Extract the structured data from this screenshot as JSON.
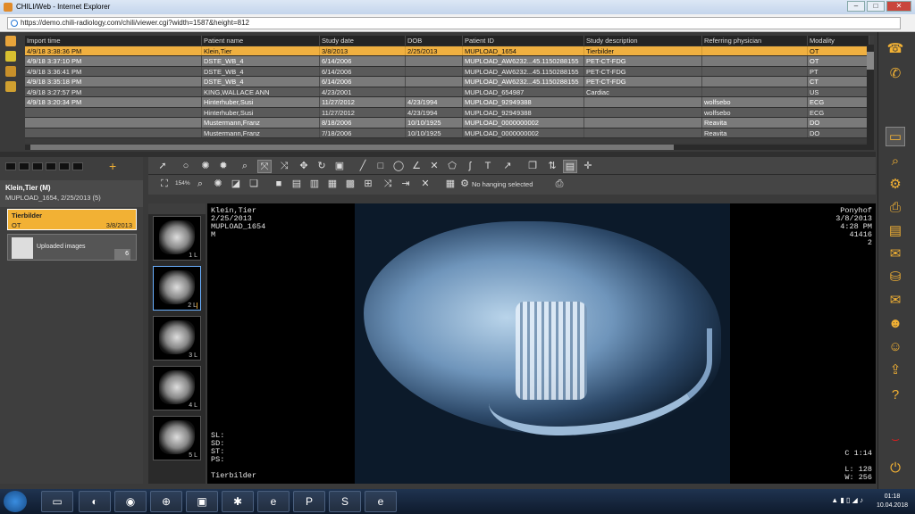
{
  "window": {
    "title": "CHILI/Web - Internet Explorer",
    "url": "https://demo.chili-radiology.com/chili/viewer.cgi?width=1587&height=812"
  },
  "table": {
    "headers": [
      "Import time",
      "Patient name",
      "Study date",
      "DOB",
      "Patient ID",
      "Study description",
      "Referring physician",
      "Modality"
    ],
    "rows": [
      {
        "style": "sel",
        "cells": [
          "4/9/18 3:38:36 PM",
          "Klein,Tier",
          "3/8/2013",
          "2/25/2013",
          "MUPLOAD_1654",
          "Tierbilder",
          "",
          "OT"
        ]
      },
      {
        "style": "alt",
        "cells": [
          "4/9/18 3:37:10 PM",
          "DSTE_WB_4",
          "6/14/2006",
          "",
          "MUPLOAD_AW6232...45.1150288155",
          "PET-CT-FDG",
          "",
          "OT"
        ]
      },
      {
        "style": "plain",
        "cells": [
          "4/9/18 3:36:41 PM",
          "DSTE_WB_4",
          "6/14/2006",
          "",
          "MUPLOAD_AW6232...45.1150288155",
          "PET-CT-FDG",
          "",
          "PT"
        ]
      },
      {
        "style": "alt",
        "cells": [
          "4/9/18 3:35:18 PM",
          "DSTE_WB_4",
          "6/14/2006",
          "",
          "MUPLOAD_AW6232...45.1150288155",
          "PET-CT-FDG",
          "",
          "CT"
        ]
      },
      {
        "style": "plain",
        "cells": [
          "4/9/18 3:27:57 PM",
          "KING,WALLACE ANN",
          "4/23/2001",
          "",
          "MUPLOAD_654987",
          "Cardiac",
          "",
          "US"
        ]
      },
      {
        "style": "alt",
        "cells": [
          "4/9/18 3:20:34 PM",
          "Hinterhuber,Susi",
          "11/27/2012",
          "4/23/1994",
          "MUPLOAD_92949388",
          "",
          "wolfsebo",
          "ECG"
        ]
      },
      {
        "style": "plain",
        "cells": [
          "",
          "Hinterhuber,Susi",
          "11/27/2012",
          "4/23/1994",
          "MUPLOAD_92949388",
          "",
          "wolfsebo",
          "ECG"
        ]
      },
      {
        "style": "alt",
        "cells": [
          "",
          "Mustermann,Franz",
          "8/18/2006",
          "10/10/1925",
          "MUPLOAD_0000000002",
          "",
          "Reavita",
          "DO"
        ]
      },
      {
        "style": "plain",
        "cells": [
          "",
          "Mustermann,Franz",
          "7/18/2006",
          "10/10/1925",
          "MUPLOAD_0000000002",
          "",
          "Reavita",
          "DO"
        ]
      }
    ]
  },
  "patient": {
    "name": "Klein,Tier (M)",
    "detail": "MUPLOAD_1654, 2/25/2013 (5)"
  },
  "study": {
    "title": "Tierbilder",
    "modality": "OT",
    "date": "3/8/2013"
  },
  "series": {
    "name": "Uploaded images",
    "count": "6"
  },
  "toolbar": {
    "zoom": "154%",
    "hanging": "No hanging selected"
  },
  "thumbs": [
    "1 L",
    "2 L",
    "3 L",
    "4 L",
    "5 L"
  ],
  "overlay": {
    "tl": "Klein,Tier\n2/25/2013\nMUPLOAD_1654\nM",
    "tr": "Ponyhof\n3/8/2013\n4:28 PM\n41416\n2",
    "bl": "SL:\nSD:\nST:\nPS:\n\nTierbilder",
    "br1": "C 1:14",
    "br2": "L: 128\nW: 256"
  },
  "clock": {
    "time": "01:18",
    "date": "10.04.2018"
  }
}
